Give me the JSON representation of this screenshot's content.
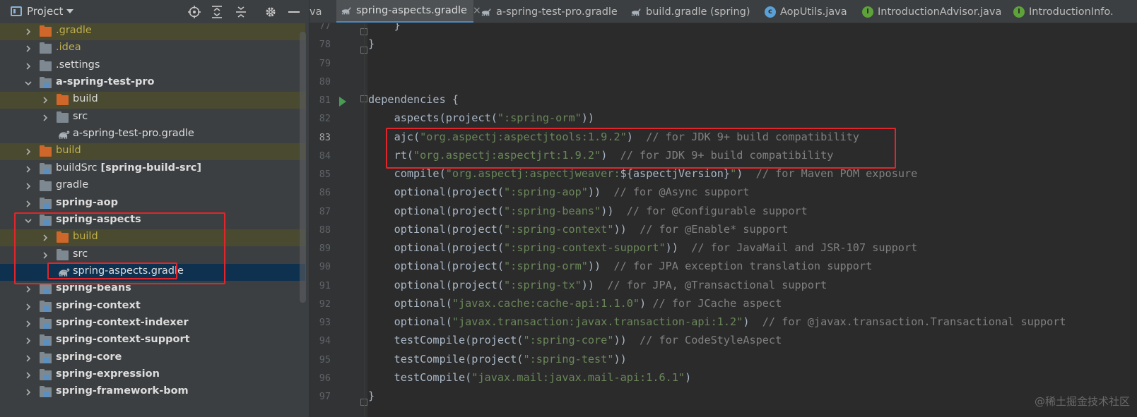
{
  "panel": {
    "title": "Project",
    "icons": [
      "locate-icon",
      "expand-all-icon",
      "collapse-all-icon",
      "gear-icon",
      "minimize-icon"
    ]
  },
  "tree": [
    {
      "label": "",
      "extra": ".gradle",
      "style": "yellow",
      "folder": "orange",
      "expanded": false,
      "tint": true
    },
    {
      "label": "",
      "extra": ".idea",
      "style": "yellow",
      "folder": "grey",
      "expanded": false,
      "tint": false
    },
    {
      "label": "",
      "extra": ".settings",
      "style": "white",
      "folder": "grey",
      "expanded": false,
      "tint": false
    },
    {
      "label": "a-spring-test-pro",
      "extra": "",
      "style": "bold",
      "folder": "module",
      "expanded": true,
      "tint": false
    },
    {
      "label": "build",
      "extra": "",
      "style": "white",
      "folder": "orange",
      "expanded": false,
      "tint": true
    },
    {
      "label": "src",
      "extra": "",
      "style": "white",
      "folder": "grey",
      "expanded": false,
      "tint": false
    },
    {
      "label": "a-spring-test-pro.gradle",
      "extra": "",
      "style": "white",
      "folder": "gradle",
      "expanded": null,
      "tint": false
    },
    {
      "label": "build",
      "extra": "",
      "style": "yellow",
      "folder": "orange",
      "expanded": false,
      "tint": true
    },
    {
      "label": "buildSrc",
      "extra": "[spring-build-src]",
      "style": "white",
      "folder": "module",
      "expanded": false,
      "tint": false
    },
    {
      "label": "gradle",
      "extra": "",
      "style": "white",
      "folder": "grey",
      "expanded": false,
      "tint": false
    },
    {
      "label": "spring-aop",
      "extra": "",
      "style": "bold",
      "folder": "module",
      "expanded": false,
      "tint": false
    },
    {
      "label": "spring-aspects",
      "extra": "",
      "style": "bold",
      "folder": "module",
      "expanded": true,
      "tint": false
    },
    {
      "label": "build",
      "extra": "",
      "style": "yellow",
      "folder": "orange",
      "expanded": false,
      "tint": true
    },
    {
      "label": "src",
      "extra": "",
      "style": "white",
      "folder": "grey",
      "expanded": false,
      "tint": false
    },
    {
      "label": "spring-aspects.gradle",
      "extra": "",
      "style": "white",
      "folder": "gradle",
      "expanded": null,
      "tint": false,
      "selected": true
    },
    {
      "label": "spring-beans",
      "extra": "",
      "style": "bold",
      "folder": "module",
      "expanded": false,
      "tint": false
    },
    {
      "label": "spring-context",
      "extra": "",
      "style": "bold",
      "folder": "module",
      "expanded": false,
      "tint": false
    },
    {
      "label": "spring-context-indexer",
      "extra": "",
      "style": "bold",
      "folder": "module",
      "expanded": false,
      "tint": false
    },
    {
      "label": "spring-context-support",
      "extra": "",
      "style": "bold",
      "folder": "module",
      "expanded": false,
      "tint": false
    },
    {
      "label": "spring-core",
      "extra": "",
      "style": "bold",
      "folder": "module",
      "expanded": false,
      "tint": false
    },
    {
      "label": "spring-expression",
      "extra": "",
      "style": "bold",
      "folder": "module",
      "expanded": false,
      "tint": false
    },
    {
      "label": "spring-framework-bom",
      "extra": "",
      "style": "bold",
      "folder": "module",
      "expanded": false,
      "tint": false
    }
  ],
  "tabs": [
    {
      "label": "va",
      "icon": "none",
      "active": false
    },
    {
      "label": "spring-aspects.gradle",
      "icon": "gradle-icon",
      "active": true
    },
    {
      "label": "a-spring-test-pro.gradle",
      "icon": "gradle-icon",
      "active": false
    },
    {
      "label": "build.gradle (spring)",
      "icon": "gradle-icon",
      "active": false
    },
    {
      "label": "AopUtils.java",
      "icon": "java-class-icon",
      "active": false
    },
    {
      "label": "IntroductionAdvisor.java",
      "icon": "java-interface-icon",
      "active": false
    },
    {
      "label": "IntroductionInfo.",
      "icon": "java-interface-icon",
      "active": false
    }
  ],
  "editor": {
    "current_line": 83,
    "lines": [
      {
        "n": 77,
        "parts": [
          {
            "t": "    }",
            "c": ""
          }
        ]
      },
      {
        "n": 78,
        "parts": [
          {
            "t": "}",
            "c": ""
          }
        ]
      },
      {
        "n": 79,
        "parts": []
      },
      {
        "n": 80,
        "parts": []
      },
      {
        "n": 81,
        "parts": [
          {
            "t": "dependencies {",
            "c": ""
          }
        ]
      },
      {
        "n": 82,
        "parts": [
          {
            "t": "    aspects(project(",
            "c": ""
          },
          {
            "t": "\":spring-orm\"",
            "c": "str"
          },
          {
            "t": "))",
            "c": ""
          }
        ]
      },
      {
        "n": 83,
        "parts": [
          {
            "t": "    ajc(",
            "c": ""
          },
          {
            "t": "\"org.aspectj:aspectjtools:1.9.2\"",
            "c": "str"
          },
          {
            "t": ")  ",
            "c": ""
          },
          {
            "t": "// for JDK 9+ build compatibility",
            "c": "cmt"
          }
        ]
      },
      {
        "n": 84,
        "parts": [
          {
            "t": "    rt(",
            "c": ""
          },
          {
            "t": "\"org.aspectj:aspectjrt:1.9.2\"",
            "c": "str"
          },
          {
            "t": ")  ",
            "c": ""
          },
          {
            "t": "// for JDK 9+ build compatibility",
            "c": "cmt"
          }
        ]
      },
      {
        "n": 85,
        "parts": [
          {
            "t": "    compile(",
            "c": ""
          },
          {
            "t": "\"org.aspectj:aspectjweaver:",
            "c": "str"
          },
          {
            "t": "${aspectjVersion}",
            "c": "interp"
          },
          {
            "t": "\"",
            "c": "str"
          },
          {
            "t": ")  ",
            "c": ""
          },
          {
            "t": "// for Maven POM exposure",
            "c": "cmt"
          }
        ]
      },
      {
        "n": 86,
        "parts": [
          {
            "t": "    optional(project(",
            "c": ""
          },
          {
            "t": "\":spring-aop\"",
            "c": "str"
          },
          {
            "t": "))  ",
            "c": ""
          },
          {
            "t": "// for @Async support",
            "c": "cmt"
          }
        ]
      },
      {
        "n": 87,
        "parts": [
          {
            "t": "    optional(project(",
            "c": ""
          },
          {
            "t": "\":spring-beans\"",
            "c": "str"
          },
          {
            "t": "))  ",
            "c": ""
          },
          {
            "t": "// for @Configurable support",
            "c": "cmt"
          }
        ]
      },
      {
        "n": 88,
        "parts": [
          {
            "t": "    optional(project(",
            "c": ""
          },
          {
            "t": "\":spring-context\"",
            "c": "str"
          },
          {
            "t": "))  ",
            "c": ""
          },
          {
            "t": "// for @Enable* support",
            "c": "cmt"
          }
        ]
      },
      {
        "n": 89,
        "parts": [
          {
            "t": "    optional(project(",
            "c": ""
          },
          {
            "t": "\":spring-context-support\"",
            "c": "str"
          },
          {
            "t": "))  ",
            "c": ""
          },
          {
            "t": "// for JavaMail and JSR-107 support",
            "c": "cmt"
          }
        ]
      },
      {
        "n": 90,
        "parts": [
          {
            "t": "    optional(project(",
            "c": ""
          },
          {
            "t": "\":spring-orm\"",
            "c": "str"
          },
          {
            "t": "))  ",
            "c": ""
          },
          {
            "t": "// for JPA exception translation support",
            "c": "cmt"
          }
        ]
      },
      {
        "n": 91,
        "parts": [
          {
            "t": "    optional(project(",
            "c": ""
          },
          {
            "t": "\":spring-tx\"",
            "c": "str"
          },
          {
            "t": "))  ",
            "c": ""
          },
          {
            "t": "// for JPA, @Transactional support",
            "c": "cmt"
          }
        ]
      },
      {
        "n": 92,
        "parts": [
          {
            "t": "    optional(",
            "c": ""
          },
          {
            "t": "\"javax.cache:cache-api:1.1.0\"",
            "c": "str"
          },
          {
            "t": ") ",
            "c": ""
          },
          {
            "t": "// for JCache aspect",
            "c": "cmt"
          }
        ]
      },
      {
        "n": 93,
        "parts": [
          {
            "t": "    optional(",
            "c": ""
          },
          {
            "t": "\"javax.transaction:javax.transaction-api:1.2\"",
            "c": "str"
          },
          {
            "t": ")  ",
            "c": ""
          },
          {
            "t": "// for @javax.transaction.Transactional support",
            "c": "cmt"
          }
        ]
      },
      {
        "n": 94,
        "parts": [
          {
            "t": "    testCompile(project(",
            "c": ""
          },
          {
            "t": "\":spring-core\"",
            "c": "str"
          },
          {
            "t": "))  ",
            "c": ""
          },
          {
            "t": "// for CodeStyleAspect",
            "c": "cmt"
          }
        ]
      },
      {
        "n": 95,
        "parts": [
          {
            "t": "    testCompile(project(",
            "c": ""
          },
          {
            "t": "\":spring-test\"",
            "c": "str"
          },
          {
            "t": "))",
            "c": ""
          }
        ]
      },
      {
        "n": 96,
        "parts": [
          {
            "t": "    testCompile(",
            "c": ""
          },
          {
            "t": "\"javax.mail:javax.mail-api:1.6.1\"",
            "c": "str"
          },
          {
            "t": ")",
            "c": ""
          }
        ]
      },
      {
        "n": 97,
        "parts": [
          {
            "t": "}",
            "c": ""
          }
        ]
      }
    ]
  },
  "watermark": "@稀土掘金技术社区",
  "colors": {
    "highlight": "#e0262b",
    "selection": "#0e3150",
    "active_tab_underline": "#4a88c7"
  }
}
